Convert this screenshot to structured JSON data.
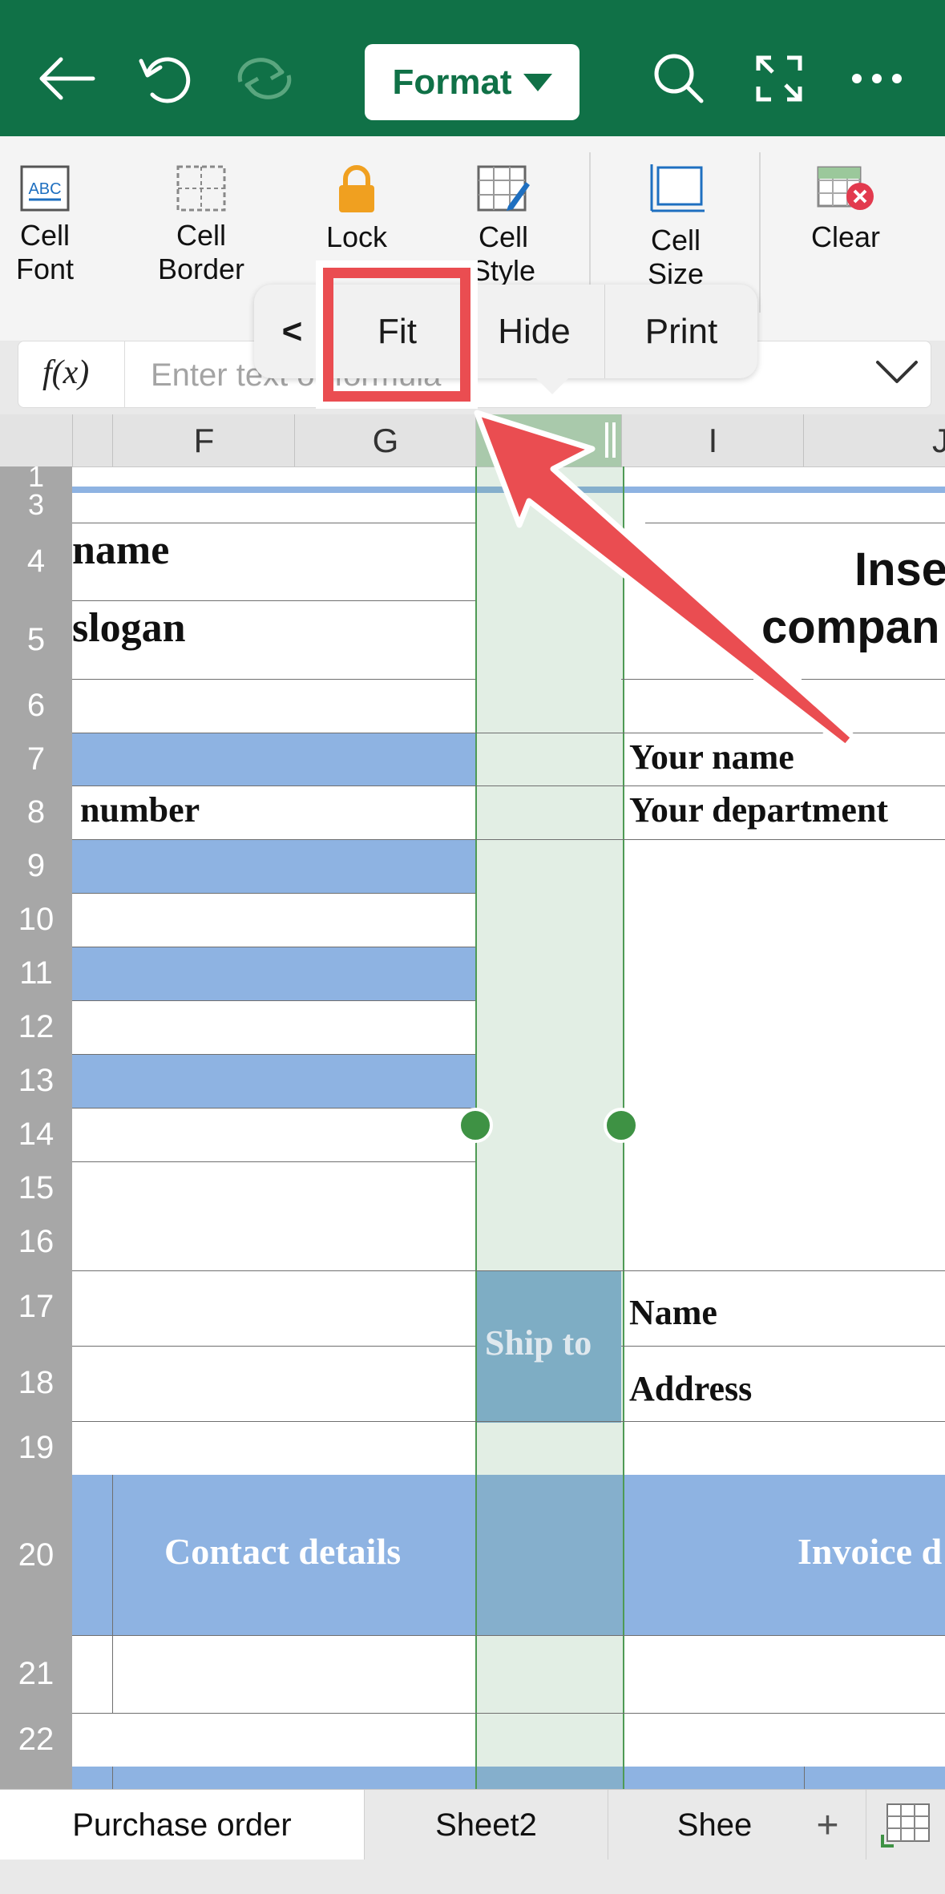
{
  "toolbar": {
    "format_label": "Format",
    "icons": [
      "back-arrow-icon",
      "undo-icon",
      "redo-icon",
      "search-icon",
      "fullscreen-icon",
      "more-icon"
    ]
  },
  "ribbon": {
    "items": [
      {
        "label": "Cell\nFont",
        "icon": "cell-font-icon"
      },
      {
        "label": "Cell\nBorder",
        "icon": "cell-border-icon"
      },
      {
        "label": "Lock",
        "icon": "lock-icon"
      },
      {
        "label": "Cell\nStyle",
        "icon": "cell-style-icon"
      },
      {
        "label": "Cell\nSize",
        "icon": "cell-size-icon"
      },
      {
        "label": "Clear",
        "icon": "clear-icon"
      }
    ]
  },
  "formula_bar": {
    "fx_label": "f(x)",
    "placeholder": "Enter text or formula"
  },
  "context_menu": {
    "back_label": "<",
    "items": [
      "Fit",
      "Hide",
      "Print"
    ]
  },
  "grid": {
    "column_headers": [
      "F",
      "G",
      "I",
      "J"
    ],
    "row_numbers": [
      "1",
      "3",
      "4",
      "5",
      "6",
      "7",
      "8",
      "9",
      "10",
      "11",
      "12",
      "13",
      "14",
      "15",
      "16",
      "17",
      "18",
      "19",
      "20",
      "21",
      "22"
    ],
    "cells": {
      "r4_left": "name",
      "r5_left": "slogan",
      "r8_left": "number",
      "r4_right": "Inse",
      "r5_right": "compan",
      "r7_right": "Your name",
      "r8_right": "Your department",
      "r17_h": "Ship to",
      "r17_right": "Name",
      "r18_right": "Address",
      "r20_left": "Contact details",
      "r20_right": "Invoice d"
    }
  },
  "sheet_tabs": [
    "Purchase order",
    "Sheet2",
    "Shee"
  ],
  "add_sheet_label": "+",
  "colors": {
    "brand_green": "#107147",
    "row_blue": "#8eb3e2",
    "annotation_red": "#ea4d51"
  }
}
